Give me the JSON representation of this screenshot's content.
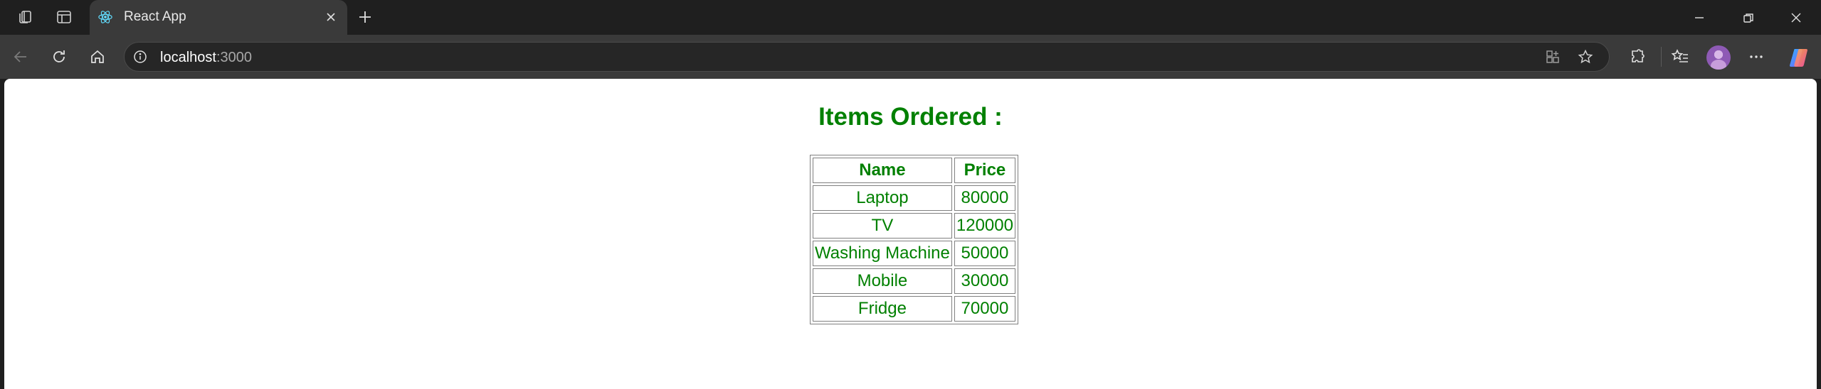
{
  "browser": {
    "tab": {
      "title": "React App"
    },
    "address_bar": {
      "host": "localhost",
      "port": ":3000"
    }
  },
  "page": {
    "heading": "Items Ordered :",
    "table": {
      "headers": [
        "Name",
        "Price"
      ],
      "rows": [
        [
          "Laptop",
          "80000"
        ],
        [
          "TV",
          "120000"
        ],
        [
          "Washing Machine",
          "50000"
        ],
        [
          "Mobile",
          "30000"
        ],
        [
          "Fridge",
          "70000"
        ]
      ]
    },
    "colors": {
      "text": "#008000",
      "border": "#808080"
    }
  },
  "icons": {
    "workspaces": "workspaces-icon",
    "tab_actions": "tab-actions-icon",
    "favicon": "react-logo-icon",
    "close": "close-icon",
    "new_tab": "plus-icon",
    "back": "back-arrow-icon",
    "refresh": "refresh-icon",
    "home": "home-icon",
    "site_info": "info-icon",
    "app_available": "app-available-icon",
    "favorite": "star-icon",
    "extensions": "puzzle-icon",
    "favorites": "favorites-list-icon",
    "more": "more-icon",
    "copilot": "copilot-icon"
  }
}
